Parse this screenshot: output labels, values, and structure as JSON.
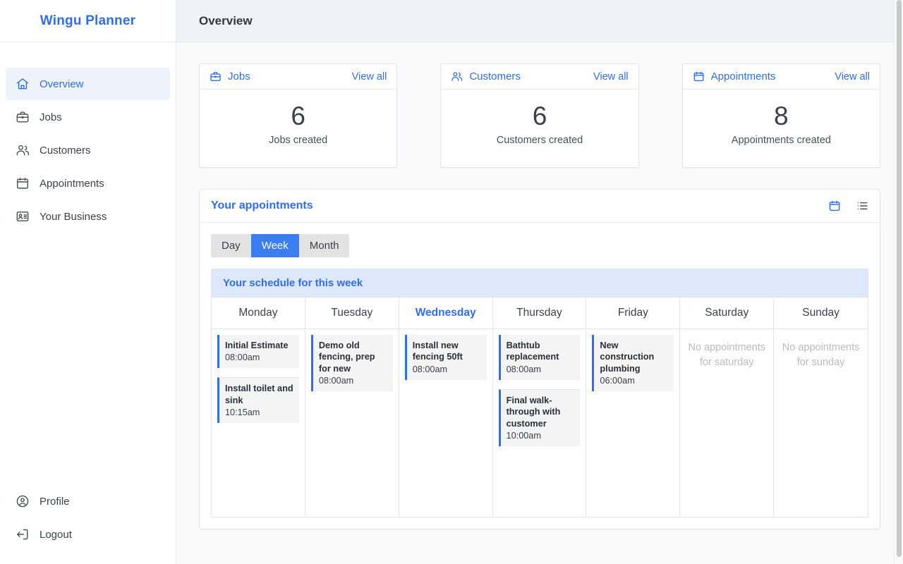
{
  "brand": {
    "name": "Wingu Planner"
  },
  "topbar": {
    "title": "Overview"
  },
  "sidebar": {
    "primary_items": [
      {
        "label": "Overview",
        "icon": "home-icon",
        "active": true
      },
      {
        "label": "Jobs",
        "icon": "briefcase-icon",
        "active": false
      },
      {
        "label": "Customers",
        "icon": "users-icon",
        "active": false
      },
      {
        "label": "Appointments",
        "icon": "calendar-icon",
        "active": false
      },
      {
        "label": "Your Business",
        "icon": "id-card-icon",
        "active": false
      }
    ],
    "secondary_items": [
      {
        "label": "Profile",
        "icon": "user-circle-icon"
      },
      {
        "label": "Logout",
        "icon": "logout-icon"
      }
    ]
  },
  "stats": [
    {
      "title": "Jobs",
      "icon": "briefcase-icon",
      "view_all": "View all",
      "number": "6",
      "label": "Jobs created"
    },
    {
      "title": "Customers",
      "icon": "users-icon",
      "view_all": "View all",
      "number": "6",
      "label": "Customers created"
    },
    {
      "title": "Appointments",
      "icon": "calendar-icon",
      "view_all": "View all",
      "number": "8",
      "label": "Appointments created"
    }
  ],
  "appointments_panel": {
    "title": "Your appointments",
    "actions": [
      {
        "icon": "calendar-view-icon",
        "active": true
      },
      {
        "icon": "list-view-icon",
        "active": false
      }
    ],
    "view_toggle": {
      "options": [
        "Day",
        "Week",
        "Month"
      ],
      "selected": "Week"
    },
    "schedule_banner": "Your schedule for this week",
    "days": [
      {
        "name": "Monday",
        "today": false,
        "appointments": [
          {
            "title": "Initial Estimate",
            "time": "08:00am"
          },
          {
            "title": "Install toilet and sink",
            "time": "10:15am"
          }
        ],
        "empty_text": ""
      },
      {
        "name": "Tuesday",
        "today": false,
        "appointments": [
          {
            "title": "Demo old fencing, prep for new",
            "time": "08:00am"
          }
        ],
        "empty_text": ""
      },
      {
        "name": "Wednesday",
        "today": true,
        "appointments": [
          {
            "title": "Install new fencing 50ft",
            "time": "08:00am"
          }
        ],
        "empty_text": ""
      },
      {
        "name": "Thursday",
        "today": false,
        "appointments": [
          {
            "title": "Bathtub replacement",
            "time": "08:00am"
          },
          {
            "title": "Final walk-through with customer",
            "time": "10:00am"
          }
        ],
        "empty_text": ""
      },
      {
        "name": "Friday",
        "today": false,
        "appointments": [
          {
            "title": "New construction plumbing",
            "time": "06:00am"
          }
        ],
        "empty_text": ""
      },
      {
        "name": "Saturday",
        "today": false,
        "appointments": [],
        "empty_text": "No appointments for saturday"
      },
      {
        "name": "Sunday",
        "today": false,
        "appointments": [],
        "empty_text": "No appointments for sunday"
      }
    ]
  },
  "colors": {
    "accent": "#2f6df6",
    "accent_button": "#3b7ef3",
    "banner_bg": "#dde8fd",
    "topbar_bg": "#eff2f7",
    "page_bg": "#fafafa",
    "appointment_bg": "#f4f4f4",
    "muted_text": "#b9bbc0"
  }
}
